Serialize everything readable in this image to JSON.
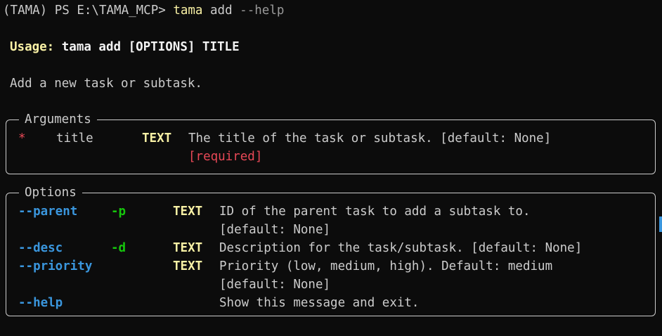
{
  "prompt": {
    "env": "(TAMA) PS E:\\TAMA_MCP> ",
    "command": "tama",
    "args": " add ",
    "flag": "--help"
  },
  "usage": {
    "label": "Usage:",
    "text": " tama add [OPTIONS] TITLE"
  },
  "description": "Add a new task or subtask.",
  "arguments_panel": {
    "title": "Arguments",
    "rows": [
      {
        "marker": "*",
        "name": "title",
        "type": "TEXT",
        "help_line1": "The title of the task or subtask. [default: None]",
        "help_line2": "[required]"
      }
    ]
  },
  "options_panel": {
    "title": "Options",
    "rows": [
      {
        "long": "--parent",
        "short": "-p",
        "type": "TEXT",
        "help_line1": "ID of the parent task to add a subtask to.",
        "help_line2": "[default: None]"
      },
      {
        "long": "--desc",
        "short": "-d",
        "type": "TEXT",
        "help_line1": "Description for the task/subtask. [default: None]",
        "help_line2": ""
      },
      {
        "long": "--priority",
        "short": "",
        "type": "TEXT",
        "help_line1": "Priority (low, medium, high). Default: medium",
        "help_line2": "[default: None]"
      },
      {
        "long": "--help",
        "short": "",
        "type": "",
        "help_line1": "Show this message and exit.",
        "help_line2": ""
      }
    ]
  }
}
